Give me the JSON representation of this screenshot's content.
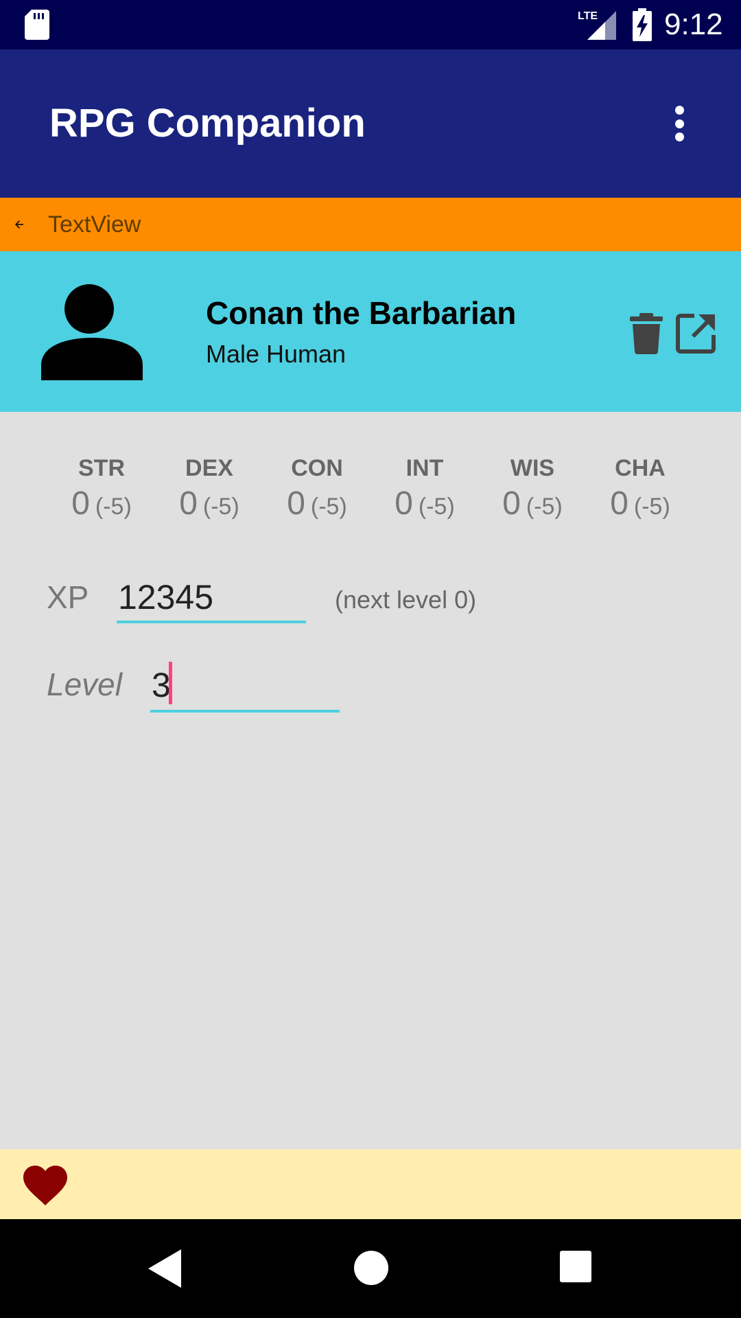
{
  "status_bar": {
    "time": "9:12",
    "network": "LTE",
    "icons": [
      "sd-card-icon",
      "lte-signal-icon",
      "battery-charging-icon"
    ]
  },
  "app_bar": {
    "title": "RPG Companion",
    "overflow_icon": "more-vert-icon"
  },
  "sub_bar": {
    "text": "TextView",
    "back_icon": "arrow-back-icon"
  },
  "character": {
    "name": "Conan the Barbarian",
    "subtitle": "Male Human",
    "avatar_icon": "person-icon",
    "actions": [
      "delete-icon",
      "open-in-new-icon"
    ]
  },
  "stats": [
    {
      "label": "STR",
      "value": "0",
      "modifier": "(-5)"
    },
    {
      "label": "DEX",
      "value": "0",
      "modifier": "(-5)"
    },
    {
      "label": "CON",
      "value": "0",
      "modifier": "(-5)"
    },
    {
      "label": "INT",
      "value": "0",
      "modifier": "(-5)"
    },
    {
      "label": "WIS",
      "value": "0",
      "modifier": "(-5)"
    },
    {
      "label": "CHA",
      "value": "0",
      "modifier": "(-5)"
    }
  ],
  "xp": {
    "label": "XP",
    "value": "12345",
    "next_level": "(next level 0)"
  },
  "level": {
    "label": "Level",
    "value": "3"
  },
  "footer": {
    "icon": "heart-icon"
  },
  "colors": {
    "status_bar": "#000051",
    "app_bar": "#1a237e",
    "sub_bar": "#ff8c00",
    "header": "#4dd0e1",
    "accent": "#ff4081",
    "background": "#e0e0e0",
    "banner": "#ffeeb0",
    "heart": "#8b0000"
  }
}
